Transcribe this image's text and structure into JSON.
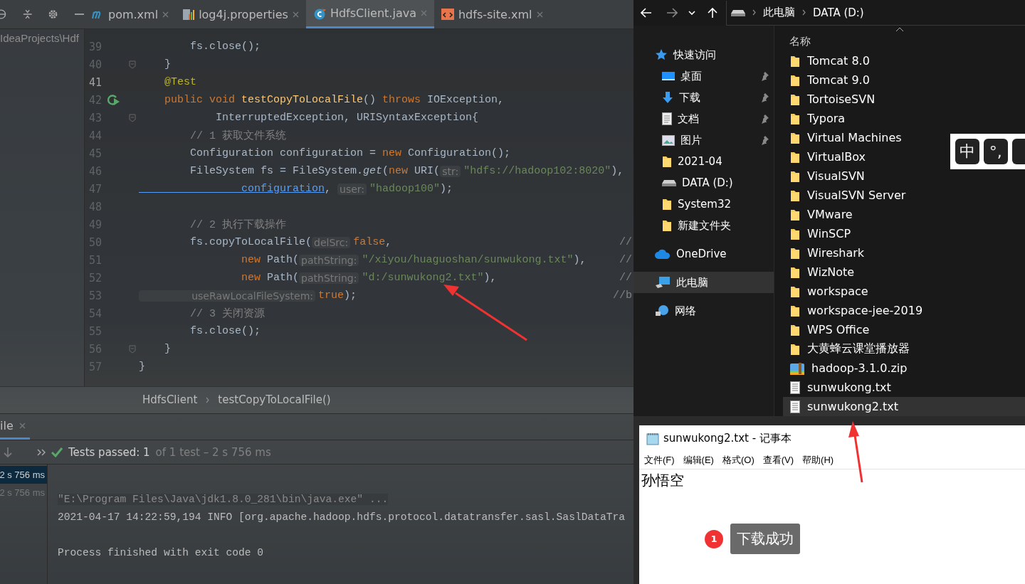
{
  "ide": {
    "tabs": [
      {
        "label": "pom.xml",
        "kind": "maven",
        "selected": false
      },
      {
        "label": "log4j.properties",
        "kind": "properties",
        "selected": false
      },
      {
        "label": "HdfsClient.java",
        "kind": "class",
        "selected": true
      },
      {
        "label": "hdfs-site.xml",
        "kind": "xml",
        "selected": false
      }
    ],
    "project_path": "IdeaProjects\\Hdf",
    "lines": [
      {
        "number": "39",
        "current": false,
        "runnable": false,
        "fold": false,
        "tokens": [
          {
            "kind": "plain",
            "text": "        fs.close();"
          }
        ]
      },
      {
        "number": "40",
        "current": false,
        "runnable": false,
        "fold": true,
        "tokens": [
          {
            "kind": "plain",
            "text": "    }"
          }
        ]
      },
      {
        "number": "41",
        "current": true,
        "runnable": false,
        "fold": false,
        "tokens": [
          {
            "kind": "ann",
            "text": "    @Test"
          }
        ]
      },
      {
        "number": "42",
        "current": false,
        "runnable": true,
        "fold": false,
        "tokens": [
          {
            "kind": "kw",
            "text": "    public void "
          },
          {
            "kind": "method",
            "text": "testCopyToLocalFile"
          },
          {
            "kind": "plain",
            "text": "() "
          },
          {
            "kind": "kw",
            "text": "throws "
          },
          {
            "kind": "plain",
            "text": "IOException,"
          }
        ]
      },
      {
        "number": "43",
        "current": false,
        "runnable": false,
        "fold": true,
        "tokens": [
          {
            "kind": "plain",
            "text": "            InterruptedException, URISyntaxException{"
          }
        ]
      },
      {
        "number": "44",
        "current": false,
        "runnable": false,
        "fold": false,
        "tokens": [
          {
            "kind": "comment",
            "text": "        // 1 获取文件系统"
          }
        ]
      },
      {
        "number": "45",
        "current": false,
        "runnable": false,
        "fold": false,
        "tokens": [
          {
            "kind": "plain",
            "text": "        Configuration configuration = "
          },
          {
            "kind": "kw",
            "text": "new "
          },
          {
            "kind": "plain",
            "text": "Configuration();"
          }
        ]
      },
      {
        "number": "46",
        "current": false,
        "runnable": false,
        "fold": false,
        "tokens": [
          {
            "kind": "plain",
            "text": "        FileSystem fs = FileSystem."
          },
          {
            "kind": "italic",
            "text": "get"
          },
          {
            "kind": "plain",
            "text": "("
          },
          {
            "kind": "kw",
            "text": "new "
          },
          {
            "kind": "plain",
            "text": "URI("
          },
          {
            "kind": "hint",
            "text": "str:"
          },
          {
            "kind": "str",
            "text": "\"hdfs://hadoop102:8020\""
          },
          {
            "kind": "plain",
            "text": "),"
          }
        ]
      },
      {
        "number": "47",
        "current": false,
        "runnable": false,
        "fold": false,
        "tokens": [
          {
            "kind": "link",
            "text": "                configuration"
          },
          {
            "kind": "plain",
            "text": ", "
          },
          {
            "kind": "hint",
            "text": "user:"
          },
          {
            "kind": "str",
            "text": "\"hadoop100\""
          },
          {
            "kind": "plain",
            "text": ");"
          }
        ]
      },
      {
        "number": "48",
        "current": false,
        "runnable": false,
        "fold": false
      },
      {
        "number": "49",
        "current": false,
        "runnable": false,
        "fold": false,
        "tokens": [
          {
            "kind": "comment",
            "text": "        // 2 执行下载操作"
          }
        ]
      },
      {
        "number": "50",
        "current": false,
        "runnable": false,
        "fold": false,
        "trail": "//",
        "tokens": [
          {
            "kind": "plain",
            "text": "        fs.copyToLocalFile("
          },
          {
            "kind": "hint",
            "text": "delSrc:"
          },
          {
            "kind": "kw",
            "text": "false"
          },
          {
            "kind": "plain",
            "text": ","
          }
        ]
      },
      {
        "number": "51",
        "current": false,
        "runnable": false,
        "fold": false,
        "trail": "//",
        "tokens": [
          {
            "kind": "kw",
            "text": "                new "
          },
          {
            "kind": "plain",
            "text": "Path("
          },
          {
            "kind": "hint",
            "text": "pathString:"
          },
          {
            "kind": "str",
            "text": "\"/xiyou/huaguoshan/sunwukong.txt\""
          },
          {
            "kind": "plain",
            "text": "),"
          }
        ]
      },
      {
        "number": "52",
        "current": false,
        "runnable": false,
        "fold": false,
        "trail": "//",
        "tokens": [
          {
            "kind": "kw",
            "text": "                new "
          },
          {
            "kind": "plain",
            "text": "Path("
          },
          {
            "kind": "hint",
            "text": "pathString:"
          },
          {
            "kind": "str",
            "text": "\"d:/sunwukong2.txt\""
          },
          {
            "kind": "plain",
            "text": "),"
          }
        ]
      },
      {
        "number": "53",
        "current": false,
        "runnable": false,
        "fold": false,
        "trail": "//b",
        "tokens": [
          {
            "kind": "hint",
            "text": "                useRawLocalFileSystem:"
          },
          {
            "kind": "kw",
            "text": "true"
          },
          {
            "kind": "plain",
            "text": ");"
          }
        ]
      },
      {
        "number": "54",
        "current": false,
        "runnable": false,
        "fold": false,
        "tokens": [
          {
            "kind": "comment",
            "text": "        // 3 关闭资源"
          }
        ]
      },
      {
        "number": "55",
        "current": false,
        "runnable": false,
        "fold": false,
        "tokens": [
          {
            "kind": "plain",
            "text": "        fs.close();"
          }
        ]
      },
      {
        "number": "56",
        "current": false,
        "runnable": false,
        "fold": true,
        "tokens": [
          {
            "kind": "plain",
            "text": "    }"
          }
        ]
      },
      {
        "number": "57",
        "current": false,
        "runnable": false,
        "fold": false,
        "tokens": [
          {
            "kind": "plain",
            "text": "}"
          }
        ]
      }
    ],
    "breadcrumb": [
      "HdfsClient",
      "testCopyToLocalFile()"
    ],
    "run": {
      "tab": "ile",
      "status": "Tests passed: 1",
      "detail": "of 1 test – 2 s 756 ms",
      "tree": [
        {
          "label": "2 s 756 ms",
          "selected": true
        },
        {
          "label": "2 s 756 ms",
          "selected": false
        }
      ],
      "console": [
        {
          "kind": "command",
          "text": "\"E:\\Program Files\\Java\\jdk1.8.0_281\\bin\\java.exe\" ..."
        },
        {
          "kind": "log",
          "text": "2021-04-17 14:22:59,194 INFO [org.apache.hadoop.hdfs.protocol.datatransfer.sasl.SaslDataTra"
        },
        {
          "kind": "blank"
        },
        {
          "kind": "log",
          "text": "Process finished with exit code 0"
        }
      ]
    }
  },
  "explorer": {
    "address": [
      "此电脑",
      "DATA (D:)"
    ],
    "nav": [
      {
        "label": "快速访问",
        "kind": "star",
        "pinned": false,
        "selected": false,
        "children": [
          {
            "label": "桌面",
            "kind": "desktop",
            "pinned": true,
            "selected": false
          },
          {
            "label": "下载",
            "kind": "download",
            "pinned": true,
            "selected": false
          },
          {
            "label": "文档",
            "kind": "doc",
            "pinned": true,
            "selected": false
          },
          {
            "label": "图片",
            "kind": "picture",
            "pinned": true,
            "selected": false
          },
          {
            "label": "2021-04",
            "kind": "folder",
            "pinned": false,
            "selected": false
          },
          {
            "label": "DATA (D:)",
            "kind": "drive",
            "pinned": false,
            "selected": false
          },
          {
            "label": "System32",
            "kind": "folder",
            "pinned": false,
            "selected": false
          },
          {
            "label": "新建文件夹",
            "kind": "folder",
            "pinned": false,
            "selected": false
          }
        ]
      },
      {
        "label": "OneDrive",
        "kind": "cloud",
        "pinned": false,
        "selected": false
      },
      {
        "label": "此电脑",
        "kind": "pc",
        "pinned": false,
        "selected": true
      },
      {
        "label": "网络",
        "kind": "network",
        "pinned": false,
        "selected": false
      }
    ],
    "column": "名称",
    "files": [
      {
        "name": "Tomcat 8.0",
        "kind": "folder",
        "selected": false
      },
      {
        "name": "Tomcat 9.0",
        "kind": "folder",
        "selected": false
      },
      {
        "name": "TortoiseSVN",
        "kind": "folder",
        "selected": false
      },
      {
        "name": "Typora",
        "kind": "folder",
        "selected": false
      },
      {
        "name": "Virtual Machines",
        "kind": "folder",
        "selected": false
      },
      {
        "name": "VirtualBox",
        "kind": "folder",
        "selected": false
      },
      {
        "name": "VisualSVN",
        "kind": "folder",
        "selected": false
      },
      {
        "name": "VisualSVN Server",
        "kind": "folder",
        "selected": false
      },
      {
        "name": "VMware",
        "kind": "folder",
        "selected": false
      },
      {
        "name": "WinSCP",
        "kind": "folder",
        "selected": false
      },
      {
        "name": "Wireshark",
        "kind": "folder",
        "selected": false
      },
      {
        "name": "WizNote",
        "kind": "folder",
        "selected": false
      },
      {
        "name": "workspace",
        "kind": "folder",
        "selected": false
      },
      {
        "name": "workspace-jee-2019",
        "kind": "folder",
        "selected": false
      },
      {
        "name": "WPS Office",
        "kind": "folder",
        "selected": false
      },
      {
        "name": "大黄蜂云课堂播放器",
        "kind": "folder",
        "selected": false
      },
      {
        "name": "hadoop-3.1.0.zip",
        "kind": "zip",
        "selected": false
      },
      {
        "name": "sunwukong.txt",
        "kind": "txt",
        "selected": false
      },
      {
        "name": "sunwukong2.txt",
        "kind": "txt",
        "selected": true
      }
    ]
  },
  "ime": {
    "keys": [
      "中",
      "°,"
    ]
  },
  "notepad": {
    "title": "sunwukong2.txt - 记事本",
    "menu": [
      "文件(F)",
      "编辑(E)",
      "格式(O)",
      "查看(V)",
      "帮助(H)"
    ],
    "content": "孙悟空",
    "callout": {
      "number": "1",
      "text": "下载成功"
    }
  }
}
